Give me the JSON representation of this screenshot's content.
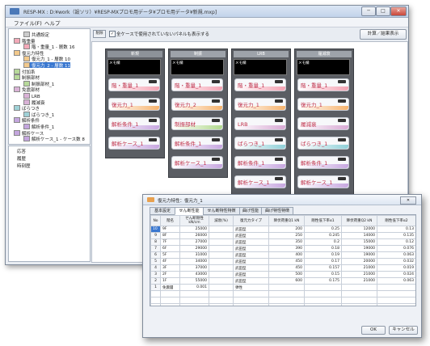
{
  "window": {
    "title": "RESP-MX : D:¥work（設ソリ）¥RESP-MXプロモ用データ¥プロモ用データ¥新規.mxp]",
    "min": "─",
    "max": "□",
    "close": "✕"
  },
  "menu": [
    "ファイル(F)",
    "ヘルプ"
  ],
  "tree": [
    {
      "label": "共通設定",
      "depth": 1,
      "color": "#cccccc"
    },
    {
      "label": "階重量",
      "depth": 0,
      "color": "#f3a9b8"
    },
    {
      "label": "階・重量_1 - 層数 16",
      "depth": 1,
      "color": "#f3a9b8"
    },
    {
      "label": "復元力特性",
      "depth": 0,
      "color": "#f2c98c"
    },
    {
      "label": "復元力_1 - 層数 10",
      "depth": 1,
      "color": "#f2c98c"
    },
    {
      "label": "復元力_2 - 層数 11",
      "depth": 1,
      "color": "#f2c98c",
      "selected": true
    },
    {
      "label": "付加系",
      "depth": 0,
      "color": "#b7d99a"
    },
    {
      "label": "制振部材",
      "depth": 0,
      "color": "#b7d99a"
    },
    {
      "label": "制振部材_1",
      "depth": 1,
      "color": "#b7d99a"
    },
    {
      "label": "免震部材",
      "depth": 0,
      "color": "#d9b2d6"
    },
    {
      "label": "LRB",
      "depth": 1,
      "color": "#d9b2d6"
    },
    {
      "label": "履減衰",
      "depth": 1,
      "color": "#d9b2d6"
    },
    {
      "label": "ばらつき",
      "depth": 0,
      "color": "#9fd1d6"
    },
    {
      "label": "ばらつき_1",
      "depth": 1,
      "color": "#9fd1d6"
    },
    {
      "label": "解析条件",
      "depth": 0,
      "color": "#c4a6de"
    },
    {
      "label": "解析条件_1",
      "depth": 1,
      "color": "#c4a6de"
    },
    {
      "label": "解析ケース",
      "depth": 0,
      "color": "#c4a6de"
    },
    {
      "label": "解析ケース_1 - ケース数 8",
      "depth": 1,
      "color": "#c4a6de"
    }
  ],
  "tree2": [
    "応答",
    "履歴",
    "時刻歴"
  ],
  "toolbar": {
    "left_btn": "削除",
    "checkbox_checked": "✓",
    "checkbox_label": "全ケースで使用されていないパネルも表示する",
    "result_btn": "計算／結果表示"
  },
  "columns": [
    {
      "header": "新規",
      "note": "メモ欄",
      "cards": [
        {
          "label": "階・重量_1",
          "color": "#f4a3b3"
        },
        {
          "label": "復元力_1",
          "color": "#f6b36d"
        },
        {
          "label": "解析条件_1",
          "color": "#c7a7e0"
        },
        {
          "label": "解析ケース_1",
          "color": "#c7a7e0"
        }
      ]
    },
    {
      "header": "制振",
      "note": "メモ欄",
      "cards": [
        {
          "label": "階・重量_1",
          "color": "#f4a3b3"
        },
        {
          "label": "復元力_2",
          "color": "#f6b36d"
        },
        {
          "label": "制振部材",
          "color": "#b2d98e"
        },
        {
          "label": "解析条件_1",
          "color": "#c7a7e0"
        },
        {
          "label": "解析ケース_1",
          "color": "#c7a7e0"
        }
      ]
    },
    {
      "header": "LRB",
      "note": "メモ欄",
      "cards": [
        {
          "label": "階・重量_1",
          "color": "#f4a3b3"
        },
        {
          "label": "復元力_1",
          "color": "#f6b36d"
        },
        {
          "label": "LRB",
          "color": "#d8a9d4"
        },
        {
          "label": "ばらつき_1",
          "color": "#8fd0d8"
        },
        {
          "label": "解析条件_1",
          "color": "#c7a7e0"
        },
        {
          "label": "解析ケース_1",
          "color": "#c7a7e0"
        }
      ]
    },
    {
      "header": "履減衰",
      "note": "メモ欄",
      "cards": [
        {
          "label": "階・重量_1",
          "color": "#f4a3b3"
        },
        {
          "label": "復元力_1",
          "color": "#f6b36d"
        },
        {
          "label": "履減衰",
          "color": "#d8a9d4"
        },
        {
          "label": "ばらつき_1",
          "color": "#8fd0d8"
        },
        {
          "label": "解析条件_1",
          "color": "#c7a7e0"
        },
        {
          "label": "解析ケース_1",
          "color": "#c7a7e0"
        }
      ]
    }
  ],
  "dialog": {
    "title": "復元力特性：復元力_1",
    "tabs": [
      "基本設定",
      "せん断性能",
      "せん断特性特徴",
      "曲げ性能",
      "曲げ特性特徴"
    ],
    "headers": [
      "No",
      "階名",
      "せん断剛性\nkN/cm",
      "減衰(%)",
      "復元力タイプ",
      "降伏荷重Q1\nkN",
      "剛性低下率α1",
      "降伏荷重Q2\nkN",
      "剛性低下率α2"
    ],
    "rows": [
      [
        "10",
        "9F",
        "25000",
        "",
        "武田型",
        "200",
        "0.25",
        "12000",
        "0.13"
      ],
      [
        "9",
        "8F",
        "26000",
        "",
        "武田型",
        "250",
        "0.245",
        "14000",
        "0.135"
      ],
      [
        "8",
        "7F",
        "27000",
        "",
        "武田型",
        "350",
        "0.2",
        "15000",
        "0.12"
      ],
      [
        "7",
        "6F",
        "29000",
        "",
        "武田型",
        "390",
        "0.18",
        "19000",
        "0.076"
      ],
      [
        "6",
        "5F",
        "31000",
        "",
        "武田型",
        "400",
        "0.19",
        "19000",
        "0.063"
      ],
      [
        "5",
        "4F",
        "34000",
        "",
        "武田型",
        "450",
        "0.17",
        "20000",
        "0.032"
      ],
      [
        "4",
        "3F",
        "37000",
        "",
        "武田型",
        "450",
        "0.157",
        "21000",
        "0.019"
      ],
      [
        "3",
        "2F",
        "43000",
        "",
        "武田型",
        "500",
        "0.15",
        "21000",
        "0.024"
      ],
      [
        "2",
        "1F",
        "55000",
        "",
        "武田型",
        "600",
        "0.175",
        "21000",
        "0.063"
      ],
      [
        "1",
        "免震層",
        "0.001",
        "",
        "弾性",
        "",
        "",
        "",
        ""
      ]
    ],
    "ok": "OK",
    "cancel": "キャンセル"
  }
}
